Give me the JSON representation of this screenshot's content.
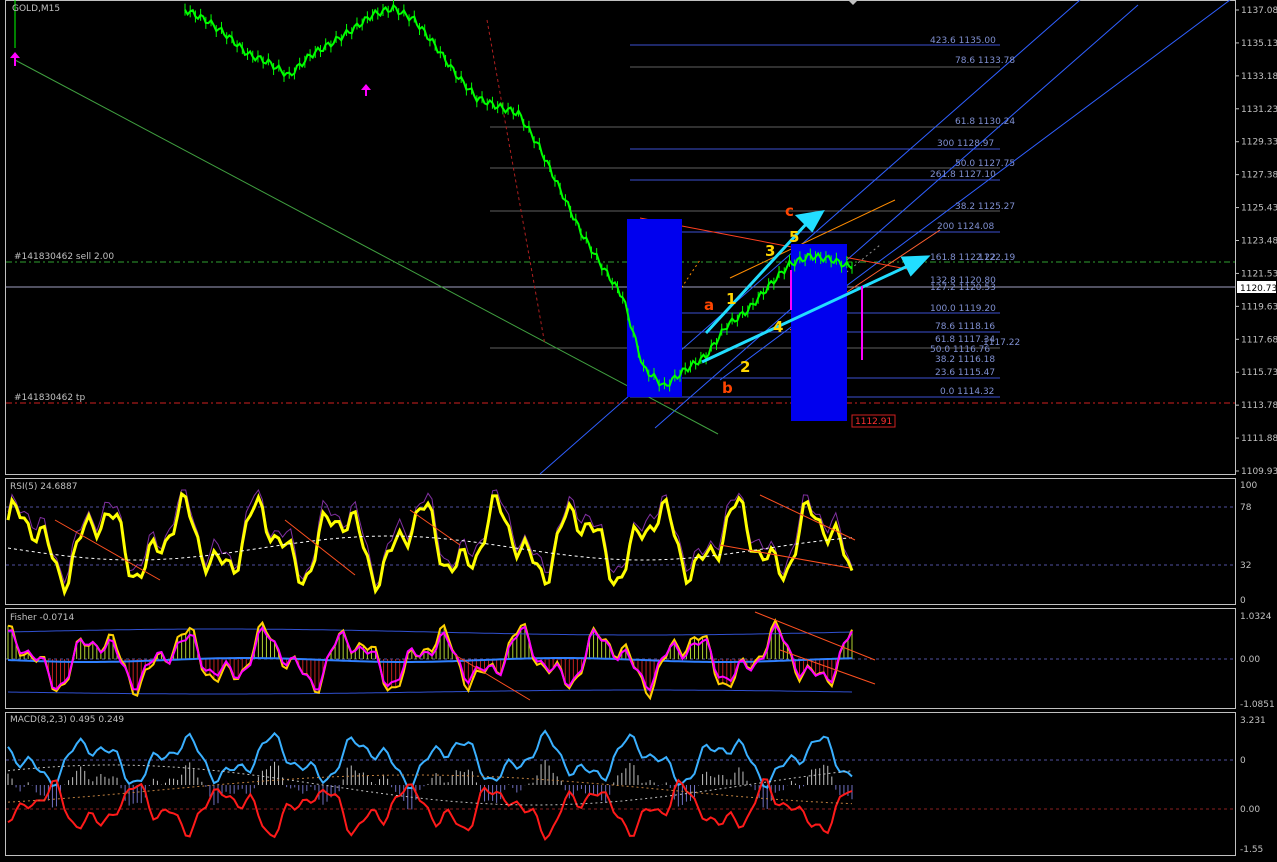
{
  "chart": {
    "symbol": "GOLD,M15",
    "order_sell_label": "#141830462 sell 2.00",
    "order_tp_label": "#141830462 tp",
    "current_price": "1120.73",
    "stop_price": "1112.91",
    "price_ticks": [
      "1137.08",
      "1135.13",
      "1133.18",
      "1131.23",
      "1129.33",
      "1127.38",
      "1125.43",
      "1123.48",
      "1121.53",
      "1119.63",
      "1117.68",
      "1115.73",
      "1113.78",
      "1111.88",
      "1109.93"
    ],
    "fib_labels": [
      "423.6 1135.00",
      "78.6 1133.78",
      "61.8 1130.24",
      "300 1128.97",
      "50.0 1127.75",
      "261.8 1127.10",
      "38.2 1125.27",
      "200 1124.08",
      "161.8 1122.22",
      "132.8 1120.80",
      "127.2 1120.53",
      "100.0 1119.20",
      "78.6 1118.16",
      "61.8 1117.34",
      "1117.22",
      "50.0 1116.76",
      "38.2 1116.18",
      "23.6 1115.47",
      "0.0 1114.32",
      "1122.19"
    ],
    "wave_labels": {
      "a": "a",
      "b": "b",
      "c": "c",
      "w1": "1",
      "w2": "2",
      "w3": "3",
      "w4": "4",
      "w5": "5"
    }
  },
  "rsi": {
    "title": "RSI(5) 24.6887",
    "ticks": [
      "100",
      "78",
      "32",
      "0"
    ]
  },
  "fisher": {
    "title": "Fisher -0.0714",
    "ticks": [
      "1.0324",
      "0.00",
      "-1.0851"
    ]
  },
  "macd": {
    "title": "MACD(8,2,3) 0.495 0.249",
    "ticks": [
      "3.231",
      "0",
      "0.00",
      "-1.55"
    ]
  },
  "colors": {
    "bull": "#00ff00",
    "rsi": "#ffff00",
    "fisher_main": "#ff00ff",
    "macd_a": "#3ab0ff",
    "macd_b": "#ff1a1a",
    "box": "#0000ee",
    "arrow": "#22ddff",
    "pink": "#ff00ff"
  },
  "chart_data": {
    "type": "line",
    "title": "GOLD,M15",
    "series": [
      {
        "name": "GOLD,M15",
        "values": [
          1137.1,
          1136.5,
          1135.6,
          1134.5,
          1134.0,
          1133.2,
          1134.4,
          1135.1,
          1135.9,
          1136.8,
          1137.2,
          1136.5,
          1135.0,
          1133.3,
          1131.9,
          1131.4,
          1131.0,
          1129.0,
          1126.5,
          1124.0,
          1122.0,
          1120.2,
          1116.0,
          1114.9,
          1115.9,
          1116.7,
          1118.5,
          1119.4,
          1120.8,
          1122.1,
          1122.6,
          1122.4,
          1121.9
        ]
      }
    ],
    "ylim": [
      1109.93,
      1137.08
    ]
  }
}
